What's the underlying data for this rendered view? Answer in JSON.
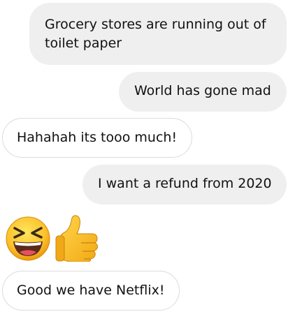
{
  "messages": [
    {
      "side": "outgoing",
      "text": "Grocery stores are running out of toilet paper"
    },
    {
      "side": "outgoing",
      "text": "World has gone mad"
    },
    {
      "side": "incoming",
      "text": "Hahahah its tooo much!"
    },
    {
      "side": "outgoing",
      "text": "I want a refund from 2020"
    },
    {
      "side": "incoming",
      "emojis": [
        "laughing-squint-face-icon",
        "thumbs-up-icon"
      ]
    },
    {
      "side": "incoming",
      "text": "Good we have Netflix!"
    }
  ],
  "colors": {
    "outgoing_bubble": "#efefef",
    "incoming_bubble": "#ffffff",
    "incoming_border": "#dbdbdb",
    "text": "#111111",
    "emoji_yellow": "#f7b500"
  }
}
